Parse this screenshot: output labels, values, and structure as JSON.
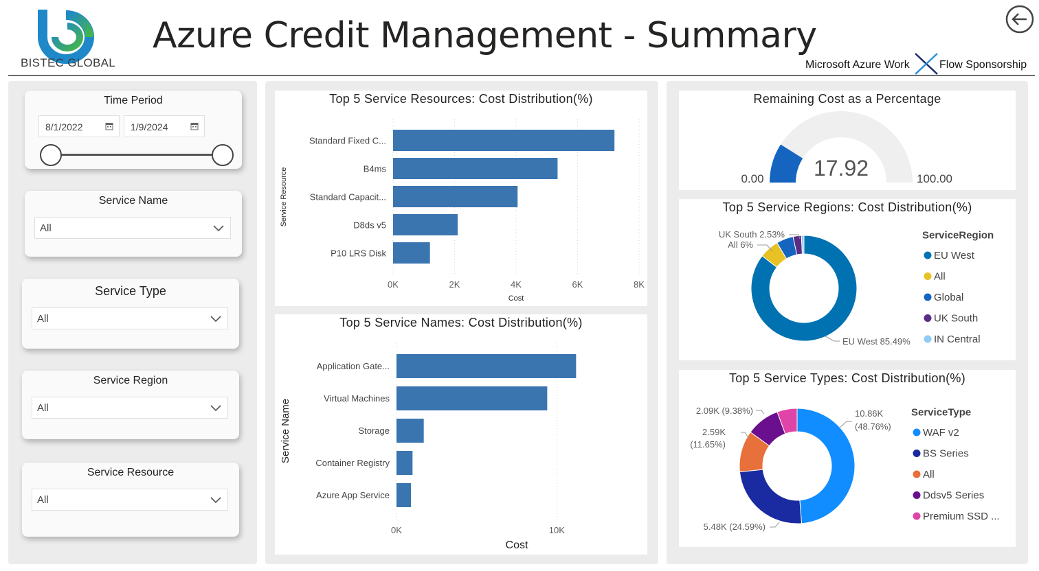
{
  "header": {
    "logo_text": "BISTEC GLOBAL",
    "title": "Azure Credit Management - Summary",
    "sponsor_left": "Microsoft Azure Work",
    "sponsor_right": "Flow Sponsorship"
  },
  "filters": {
    "time_period": {
      "title": "Time Period",
      "start": "8/1/2022",
      "end": "1/9/2024"
    },
    "service_name": {
      "title": "Service Name",
      "value": "All"
    },
    "service_type": {
      "title": "Service Type",
      "value": "All"
    },
    "service_region": {
      "title": "Service Region",
      "value": "All"
    },
    "service_resource": {
      "title": "Service Resource",
      "value": "All"
    }
  },
  "colors": {
    "bar": "#3a75b0",
    "accent": "#118dff",
    "gauge_fill": "#1565c0",
    "gauge_track": "#efefef"
  },
  "resources_chart": {
    "title": "Top 5 Service Resources: Cost Distribution(%)",
    "ylabel": "Service Resource",
    "xlabel": "Cost",
    "ticks": [
      "0K",
      "2K",
      "4K",
      "6K",
      "8K"
    ]
  },
  "names_chart": {
    "title": "Top 5 Service Names: Cost Distribution(%)",
    "ylabel": "Service Name",
    "xlabel": "Cost",
    "ticks": [
      "0K",
      "10K"
    ]
  },
  "gauge": {
    "title": "Remaining Cost as a Percentage",
    "value_label": "17.92",
    "min_label": "0.00",
    "max_label": "100.00"
  },
  "regions_chart": {
    "title": "Top 5 Service Regions: Cost Distribution(%)",
    "legend_title": "ServiceRegion",
    "labels": [
      "UK South 2.53%",
      "All 6%",
      "EU West 85.49%"
    ]
  },
  "types_chart": {
    "title": "Top 5 Service Types: Cost Distribution(%)",
    "legend_title": "ServiceType",
    "labels": [
      "10.86K",
      "(48.76%)",
      "2.09K (9.38%)",
      "2.59K",
      "(11.65%)",
      "5.48K (24.59%)"
    ]
  },
  "chart_data": [
    {
      "type": "bar",
      "orientation": "horizontal",
      "title": "Top 5 Service Resources: Cost Distribution(%)",
      "categories": [
        "Standard Fixed C...",
        "B4ms",
        "Standard Capacit...",
        "D8ds v5",
        "P10 LRS Disk"
      ],
      "values": [
        7200,
        5350,
        4050,
        2100,
        1200
      ],
      "xlabel": "Cost",
      "ylabel": "Service Resource",
      "xlim": [
        0,
        8000
      ],
      "grid": true
    },
    {
      "type": "bar",
      "orientation": "horizontal",
      "title": "Top 5 Service Names: Cost Distribution(%)",
      "categories": [
        "Application Gate...",
        "Virtual Machines",
        "Storage",
        "Container Registry",
        "Azure App Service"
      ],
      "values": [
        11200,
        9400,
        1700,
        1000,
        900
      ],
      "xlabel": "Cost",
      "ylabel": "Service Name",
      "xlim": [
        0,
        12000
      ],
      "grid": true
    },
    {
      "type": "gauge",
      "title": "Remaining Cost as a Percentage",
      "value": 17.92,
      "min": 0,
      "max": 100
    },
    {
      "type": "pie",
      "donut": true,
      "title": "Top 5 Service Regions: Cost Distribution(%)",
      "legend_title": "ServiceRegion",
      "legend_position": "right",
      "categories": [
        "EU West",
        "All",
        "Global",
        "UK South",
        "IN Central"
      ],
      "values": [
        85.49,
        6.0,
        5.2,
        2.53,
        0.78
      ],
      "colors": [
        "#0072b2",
        "#e8c124",
        "#1565c0",
        "#5b2c86",
        "#8ecbf5"
      ]
    },
    {
      "type": "pie",
      "donut": true,
      "title": "Top 5 Service Types: Cost Distribution(%)",
      "legend_title": "ServiceType",
      "legend_position": "right",
      "categories": [
        "WAF v2",
        "BS Series",
        "All",
        "Ddsv5 Series",
        "Premium SSD ..."
      ],
      "values": [
        10.86,
        5.48,
        2.59,
        2.09,
        1.25
      ],
      "percentages": [
        48.76,
        24.59,
        11.65,
        9.38,
        5.62
      ],
      "colors": [
        "#118dff",
        "#1a2aa0",
        "#e8703a",
        "#6a0f8e",
        "#e044a7"
      ]
    }
  ]
}
